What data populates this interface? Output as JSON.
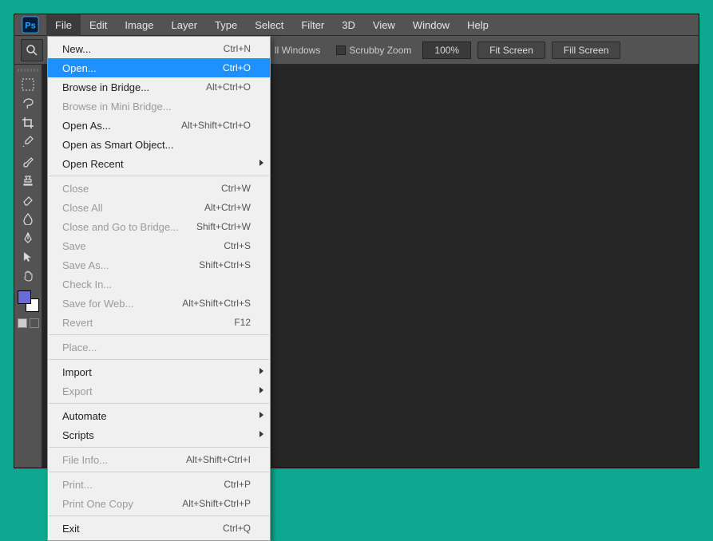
{
  "menubar": {
    "items": [
      "File",
      "Edit",
      "Image",
      "Layer",
      "Type",
      "Select",
      "Filter",
      "3D",
      "View",
      "Window",
      "Help"
    ],
    "active_index": 0
  },
  "optbar": {
    "windows_label": "ll Windows",
    "scrubby_label": "Scrubby Zoom",
    "zoom_value": "100%",
    "fit_btn": "Fit Screen",
    "fill_btn": "Fill Screen"
  },
  "dropdown": {
    "rows": [
      {
        "t": "item",
        "label": "New...",
        "shortcut": "Ctrl+N"
      },
      {
        "t": "item",
        "label": "Open...",
        "shortcut": "Ctrl+O",
        "highlight": true
      },
      {
        "t": "item",
        "label": "Browse in Bridge...",
        "shortcut": "Alt+Ctrl+O"
      },
      {
        "t": "item",
        "label": "Browse in Mini Bridge...",
        "shortcut": "",
        "disabled": true
      },
      {
        "t": "item",
        "label": "Open As...",
        "shortcut": "Alt+Shift+Ctrl+O"
      },
      {
        "t": "item",
        "label": "Open as Smart Object...",
        "shortcut": ""
      },
      {
        "t": "sub",
        "label": "Open Recent"
      },
      {
        "t": "sep"
      },
      {
        "t": "item",
        "label": "Close",
        "shortcut": "Ctrl+W",
        "disabled": true
      },
      {
        "t": "item",
        "label": "Close All",
        "shortcut": "Alt+Ctrl+W",
        "disabled": true
      },
      {
        "t": "item",
        "label": "Close and Go to Bridge...",
        "shortcut": "Shift+Ctrl+W",
        "disabled": true
      },
      {
        "t": "item",
        "label": "Save",
        "shortcut": "Ctrl+S",
        "disabled": true
      },
      {
        "t": "item",
        "label": "Save As...",
        "shortcut": "Shift+Ctrl+S",
        "disabled": true
      },
      {
        "t": "item",
        "label": "Check In...",
        "shortcut": "",
        "disabled": true
      },
      {
        "t": "item",
        "label": "Save for Web...",
        "shortcut": "Alt+Shift+Ctrl+S",
        "disabled": true
      },
      {
        "t": "item",
        "label": "Revert",
        "shortcut": "F12",
        "disabled": true
      },
      {
        "t": "sep"
      },
      {
        "t": "item",
        "label": "Place...",
        "shortcut": "",
        "disabled": true
      },
      {
        "t": "sep"
      },
      {
        "t": "sub",
        "label": "Import"
      },
      {
        "t": "sub",
        "label": "Export",
        "disabled": true
      },
      {
        "t": "sep"
      },
      {
        "t": "sub",
        "label": "Automate"
      },
      {
        "t": "sub",
        "label": "Scripts"
      },
      {
        "t": "sep"
      },
      {
        "t": "item",
        "label": "File Info...",
        "shortcut": "Alt+Shift+Ctrl+I",
        "disabled": true
      },
      {
        "t": "sep"
      },
      {
        "t": "item",
        "label": "Print...",
        "shortcut": "Ctrl+P",
        "disabled": true
      },
      {
        "t": "item",
        "label": "Print One Copy",
        "shortcut": "Alt+Shift+Ctrl+P",
        "disabled": true
      },
      {
        "t": "sep"
      },
      {
        "t": "item",
        "label": "Exit",
        "shortcut": "Ctrl+Q"
      }
    ]
  },
  "tools": [
    "marquee",
    "lasso",
    "crop",
    "eyedropper",
    "brush",
    "stamp",
    "eraser",
    "blur",
    "pen",
    "path-select",
    "hand"
  ]
}
